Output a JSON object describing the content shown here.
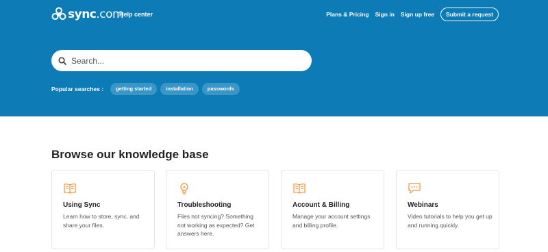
{
  "header": {
    "logo": {
      "name": "sync",
      "tld": ".com"
    },
    "help_center": "Help center",
    "nav": {
      "plans": "Plans & Pricing",
      "sign_in": "Sign in",
      "sign_up": "Sign up free",
      "submit": "Submit a request"
    }
  },
  "search": {
    "placeholder": "Search...",
    "value": ""
  },
  "popular": {
    "label": "Popular searches :",
    "items": [
      "getting started",
      "installation",
      "passwords"
    ]
  },
  "kb": {
    "title": "Browse our knowledge base",
    "cards": [
      {
        "title": "Using Sync",
        "desc": "Learn how to store, sync, and share your files.",
        "icon": "open-book-icon"
      },
      {
        "title": "Troubleshooting",
        "desc": "Files not syncing? Something not working as expected? Get answers here.",
        "icon": "lightbulb-icon"
      },
      {
        "title": "Account & Billing",
        "desc": "Manage your account settings and billing profile.",
        "icon": "open-book-icon"
      },
      {
        "title": "Webinars",
        "desc": "Video tutorials to help you get up and running quickly.",
        "icon": "chat-bubble-icon"
      }
    ]
  },
  "colors": {
    "brand_blue": "#0d7bb5",
    "chip_blue": "#3a96c6",
    "icon_orange": "#f0913a"
  }
}
